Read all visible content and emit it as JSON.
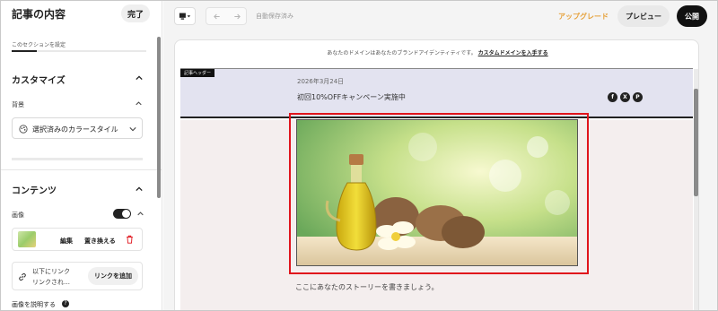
{
  "sidebar": {
    "title": "記事の内容",
    "done_label": "完了",
    "section_hint": "このセクションを設定",
    "customize": {
      "heading": "カスタマイズ",
      "background_label": "背景",
      "background_value": "選択済みのカラースタイル"
    },
    "content": {
      "heading": "コンテンツ",
      "image_label": "画像",
      "image_toggle_on": true,
      "edit_label": "編集",
      "replace_label": "置き換える",
      "link_text_line1": "以下にリンク",
      "link_text_line2": "リンクされ…",
      "add_link_label": "リンクを追加",
      "describe_label": "画像を説明する"
    }
  },
  "toolbar": {
    "autosave": "自動保存済み",
    "upgrade_label": "アップグレード",
    "preview_label": "プレビュー",
    "publish_label": "公開"
  },
  "canvas": {
    "banner_text": "あなたのドメインはあなたのブランドアイデンティティです。",
    "banner_link": "カスタムドメインを入手する",
    "header_tag": "記事ヘッダー",
    "date": "2026年3月24日",
    "title": "初回10%OFFキャンペーン実施中",
    "social_icons": [
      "facebook-icon",
      "x-icon",
      "pinterest-icon"
    ],
    "story_placeholder": "ここにあなたのストーリーを書きましょう。"
  },
  "colors": {
    "accent_upgrade": "#e6a23c",
    "highlight_red": "#e0141c",
    "header_bg": "#e3e3f0",
    "content_bg": "#f4eeee"
  }
}
